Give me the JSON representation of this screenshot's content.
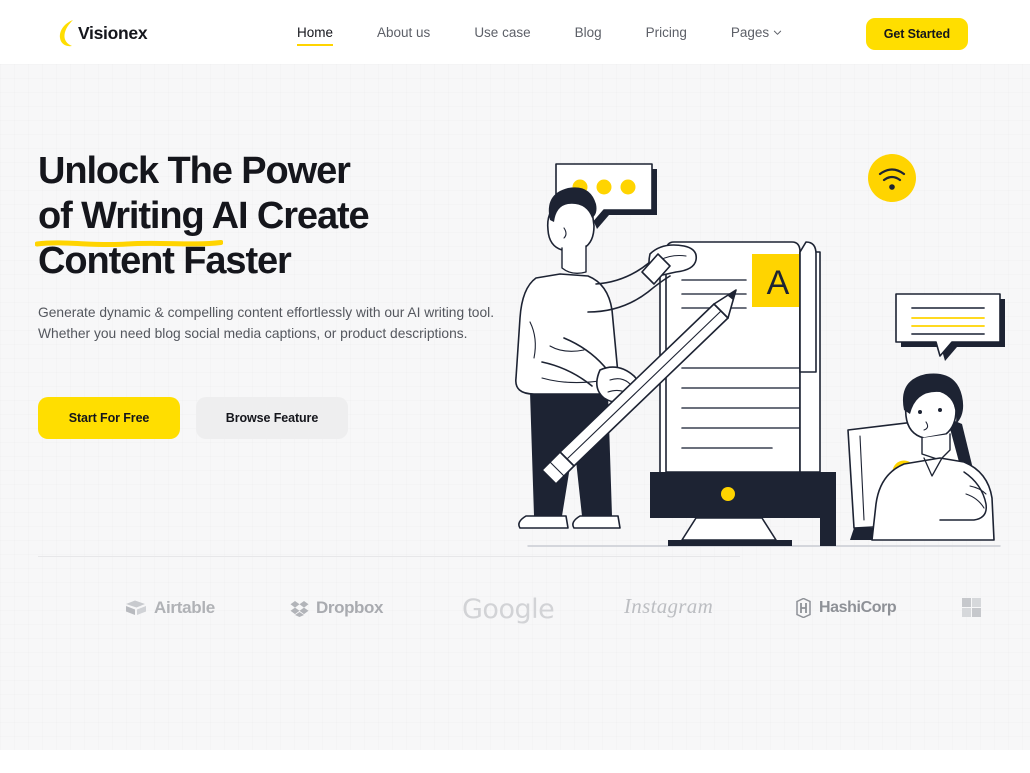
{
  "brand": {
    "name": "Visionex",
    "accent": "#FFDE00",
    "dark": "#15161c"
  },
  "header": {
    "nav": [
      {
        "label": "Home",
        "active": true,
        "has_chevron": false
      },
      {
        "label": "About us",
        "active": false,
        "has_chevron": false
      },
      {
        "label": "Use case",
        "active": false,
        "has_chevron": false
      },
      {
        "label": "Blog",
        "active": false,
        "has_chevron": false
      },
      {
        "label": "Pricing",
        "active": false,
        "has_chevron": false
      },
      {
        "label": "Pages",
        "active": false,
        "has_chevron": true
      }
    ],
    "cta_label": "Get Started"
  },
  "hero": {
    "headline_line1": "Unlock The Power",
    "headline_line2": "of Writing AI Create",
    "headline_line3": "Content Faster",
    "underline_word": "of Writing",
    "paragraph": "Generate dynamic & compelling content effortlessly with our AI writing tool. Whether you need blog social media captions, or product descriptions.",
    "primary_button": "Start For Free",
    "secondary_button": "Browse Feature",
    "illustration": {
      "letter_tile": "A",
      "icons": [
        "speech-bubble-icon",
        "wifi-icon",
        "chat-bubble-icon",
        "pencil-icon",
        "monitor-icon",
        "laptop-icon"
      ]
    }
  },
  "brands": [
    {
      "name": "Airtable",
      "icon": "airtable-icon"
    },
    {
      "name": "Dropbox",
      "icon": "dropbox-icon"
    },
    {
      "name": "Google",
      "icon": "google-wordmark"
    },
    {
      "name": "Instagram",
      "icon": "instagram-wordmark"
    },
    {
      "name": "HashiCorp",
      "icon": "hashicorp-icon"
    },
    {
      "name": "",
      "icon": "microsoft-icon"
    }
  ]
}
